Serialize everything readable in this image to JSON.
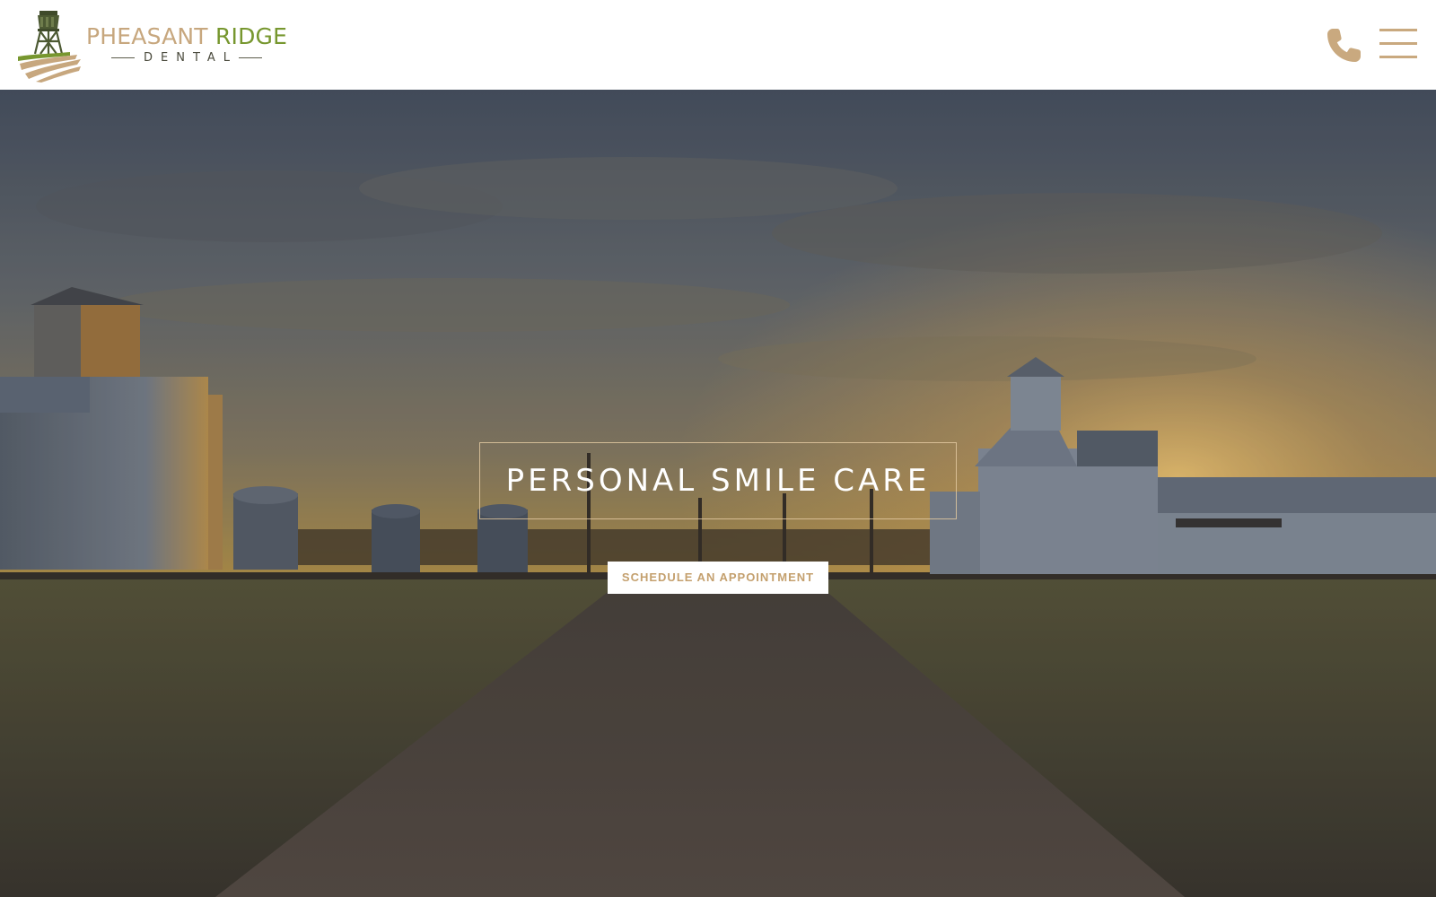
{
  "brand": {
    "name_part1": "PHEASANT",
    "name_part2": "RIDGE",
    "sub": "DENTAL",
    "logo_icon": "water-tower-field-logo",
    "colors": {
      "tan": "#c7a77e",
      "green": "#77972f",
      "dark": "#4b4b3d"
    }
  },
  "header": {
    "phone_icon": "phone-icon",
    "menu_icon": "hamburger-menu-icon",
    "accent_color": "#c9a97f"
  },
  "hero": {
    "title": "PERSONAL SMILE CARE",
    "cta_label": "SCHEDULE AN APPOINTMENT",
    "cta_text_color": "#c4a06e"
  }
}
